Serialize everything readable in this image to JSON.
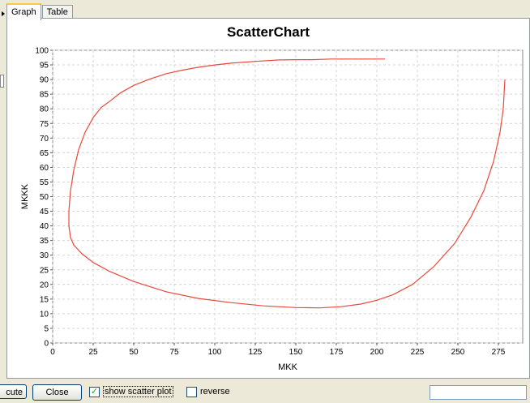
{
  "tabs": [
    {
      "label": "Graph",
      "active": true
    },
    {
      "label": "Table",
      "active": false
    }
  ],
  "colors": {
    "series": "#e8493a",
    "accent_tab": "#ffc83c"
  },
  "buttons": {
    "execute_label": "cute",
    "close_label": "Close"
  },
  "checkboxes": {
    "show_scatter": {
      "label": "show scatter plot",
      "checked": true
    },
    "reverse": {
      "label": "reverse",
      "checked": false
    }
  },
  "status_field": {
    "value": ""
  },
  "chart_data": {
    "type": "line",
    "title": "ScatterChart",
    "xlabel": "MKK",
    "ylabel": "MKKK",
    "xlim": [
      0,
      290
    ],
    "ylim": [
      0,
      100
    ],
    "xticks": [
      0,
      25,
      50,
      75,
      100,
      125,
      150,
      175,
      200,
      225,
      250,
      275
    ],
    "yticks": [
      0,
      5,
      10,
      15,
      20,
      25,
      30,
      35,
      40,
      45,
      50,
      55,
      60,
      65,
      70,
      75,
      80,
      85,
      90,
      95,
      100
    ],
    "grid": true,
    "series": [
      {
        "points": [
          [
            205,
            97
          ],
          [
            185,
            97
          ],
          [
            172,
            97
          ],
          [
            160,
            96.8
          ],
          [
            150,
            96.8
          ],
          [
            140,
            96.7
          ],
          [
            125,
            96.2
          ],
          [
            110,
            95.6
          ],
          [
            100,
            95
          ],
          [
            90,
            94.2
          ],
          [
            80,
            93.2
          ],
          [
            70,
            92
          ],
          [
            60,
            90.2
          ],
          [
            50,
            88
          ],
          [
            42,
            85.5
          ],
          [
            35,
            82.5
          ],
          [
            30,
            80.5
          ],
          [
            25,
            77
          ],
          [
            20,
            72
          ],
          [
            16,
            66
          ],
          [
            13,
            59
          ],
          [
            11,
            52
          ],
          [
            10,
            45
          ],
          [
            10,
            40
          ],
          [
            11,
            36
          ],
          [
            13,
            33.5
          ],
          [
            18,
            30.5
          ],
          [
            25,
            27.5
          ],
          [
            35,
            24.5
          ],
          [
            50,
            21
          ],
          [
            70,
            17.5
          ],
          [
            90,
            15.2
          ],
          [
            110,
            13.8
          ],
          [
            130,
            12.7
          ],
          [
            150,
            12.1
          ],
          [
            165,
            12
          ],
          [
            178,
            12.4
          ],
          [
            190,
            13.3
          ],
          [
            200,
            14.6
          ],
          [
            210,
            16.5
          ],
          [
            222,
            20
          ],
          [
            235,
            26
          ],
          [
            248,
            34
          ],
          [
            258,
            43
          ],
          [
            266,
            52
          ],
          [
            272,
            62
          ],
          [
            276,
            72
          ],
          [
            278,
            80
          ],
          [
            279,
            90
          ]
        ]
      }
    ]
  }
}
